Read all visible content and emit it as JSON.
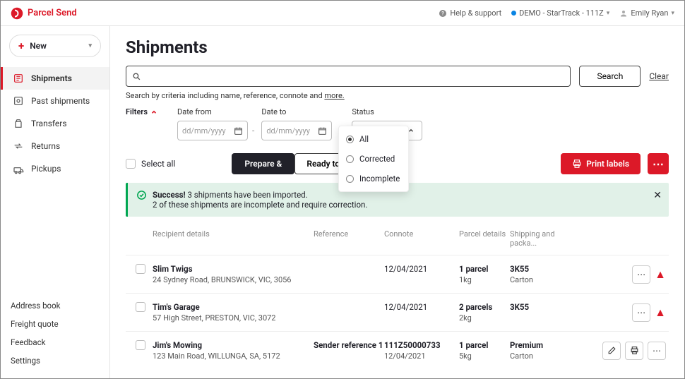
{
  "brand": "Parcel Send",
  "header": {
    "help": "Help & support",
    "account": "DEMO - StarTrack - 111Z",
    "user": "Emily Ryan"
  },
  "sidebar": {
    "new_label": "New",
    "items": [
      {
        "label": "Shipments",
        "active": true
      },
      {
        "label": "Past shipments"
      },
      {
        "label": "Transfers"
      },
      {
        "label": "Returns"
      },
      {
        "label": "Pickups"
      }
    ],
    "bottom": [
      "Address book",
      "Freight quote",
      "Feedback",
      "Settings"
    ]
  },
  "page": {
    "title": "Shipments",
    "search_btn": "Search",
    "clear": "Clear",
    "hint_prefix": "Search by criteria including name, reference, connote and ",
    "hint_more": "more.",
    "filters_label": "Filters",
    "date_from_label": "Date from",
    "date_to_label": "Date to",
    "date_placeholder": "dd/mm/yyyy",
    "status_label": "Status",
    "status_value": "All",
    "status_options": [
      "All",
      "Corrected",
      "Incomplete"
    ],
    "select_all": "Select all",
    "prepare_btn": "Prepare & ",
    "despatch_btn": "Ready to despatch (3)",
    "print_btn": "Print labels"
  },
  "alert": {
    "title": "Success!",
    "line1": " 3 shipments have been imported.",
    "line2": "2 of these shipments are incomplete and require correction."
  },
  "columns": {
    "recipient": "Recipient details",
    "reference": "Reference",
    "connote": "Connote",
    "parcel": "Parcel details",
    "shipping": "Shipping and packa..."
  },
  "rows": [
    {
      "name": "Slim Twigs",
      "addr": "24 Sydney Road, BRUNSWICK, VIC, 3056",
      "ref": "",
      "connote": "",
      "date": "12/04/2021",
      "parcels": "1 parcel",
      "weight": "1kg",
      "ship": "3K55",
      "pack": "Carton",
      "warn": true,
      "edit": false
    },
    {
      "name": "Tim's Garage",
      "addr": "57 High Street, PRESTON, VIC, 3072",
      "ref": "",
      "connote": "",
      "date": "12/04/2021",
      "parcels": "2 parcels",
      "weight": "2kg",
      "ship": "3K55",
      "pack": "",
      "warn": true,
      "edit": false
    },
    {
      "name": "Jim's Mowing",
      "addr": "123 Main Road, WILLUNGA, SA, 5172",
      "ref": "Sender reference 1",
      "connote": "111Z50000733",
      "date": "12/04/2021",
      "parcels": "1 parcel",
      "weight": "5kg",
      "ship": "Premium",
      "pack": "Carton",
      "warn": false,
      "edit": true
    }
  ]
}
